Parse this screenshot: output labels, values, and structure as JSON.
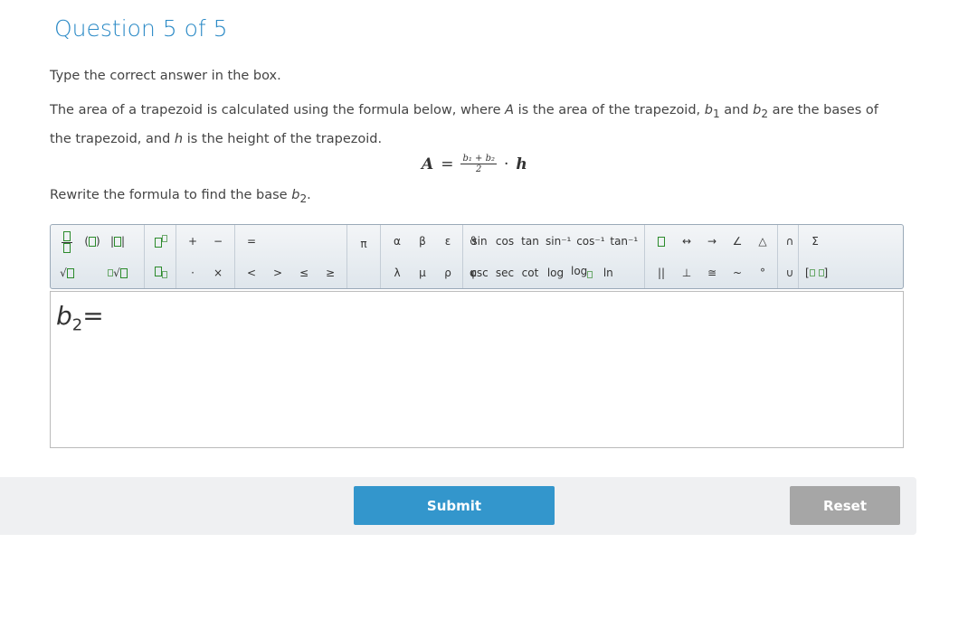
{
  "title": "Question 5 of 5",
  "instruction": "Type the correct answer in the box.",
  "prompt": {
    "p1": "The area of a trapezoid is calculated using the formula below, where ",
    "A": "A",
    " p2": "",
    "p2": " is the area of the trapezoid, ",
    "b1": "b",
    "sub1": "1",
    "and": " and ",
    "b2": "b",
    "sub2": "2",
    "p3": " are the bases of the trapezoid, and ",
    "h": "h",
    "p4": " is the height of the trapezoid."
  },
  "formula": {
    "lhs": "A",
    "eq": "=",
    "num": "b₁ + b₂",
    "den": "2",
    "dot": "·",
    "h": "h"
  },
  "rewrite": {
    "text": "Rewrite the formula to find the base ",
    "b": "b",
    "sub": "2",
    "end": "."
  },
  "toolbar": {
    "ops": {
      "plus": "+",
      "minus": "−",
      "cdot": "·",
      "times": "×",
      "eq": "=",
      "lt": "<",
      "gt": ">",
      "le": "≤",
      "ge": "≥",
      "pi": "π"
    },
    "greek": [
      [
        "α",
        "β",
        "ε",
        "ϑ"
      ],
      [
        "λ",
        "μ",
        "ρ",
        "φ"
      ]
    ],
    "trig": [
      [
        "sin",
        "cos",
        "tan",
        "sin⁻¹",
        "cos⁻¹",
        "tan⁻¹"
      ],
      [
        "csc",
        "sec",
        "cot",
        "log",
        "log",
        "ln"
      ]
    ],
    "geo": {
      "parallel": "||",
      "perp": "⊥",
      "congruent": "≅",
      "similar": "~",
      "degree": "°",
      "angle": "∠",
      "triangle": "△",
      "cap": "∩",
      "cup": "∪",
      "sigma": "Σ"
    }
  },
  "answer": {
    "var": "b",
    "sub": "2",
    "eq": "="
  },
  "buttons": {
    "submit": "Submit",
    "reset": "Reset"
  },
  "colors": {
    "title": "#2b8ac6",
    "submit": "#3396cc",
    "reset": "#a6a6a6"
  }
}
